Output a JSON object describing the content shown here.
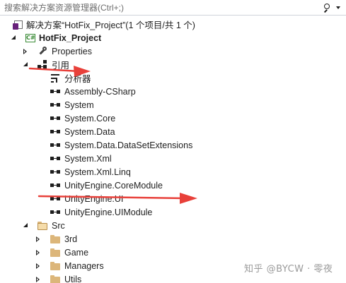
{
  "search": {
    "placeholder": "搜索解决方案资源管理器(Ctrl+;)"
  },
  "solution": {
    "label": "解决方案“HotFix_Project”(1 个项目/共 1 个)"
  },
  "project": {
    "label": "HotFix_Project"
  },
  "properties": {
    "label": "Properties"
  },
  "references": {
    "label": "引用",
    "items": [
      "分析器",
      "Assembly-CSharp",
      "System",
      "System.Core",
      "System.Data",
      "System.Data.DataSetExtensions",
      "System.Xml",
      "System.Xml.Linq",
      "UnityEngine.CoreModule",
      "UnityEngine.UI",
      "UnityEngine.UIModule"
    ]
  },
  "src": {
    "label": "Src",
    "folders": [
      "3rd",
      "Game",
      "Managers",
      "Utils"
    ]
  },
  "annotation_color": "#e8403a",
  "watermark": "知乎 @BYCW · 零夜"
}
